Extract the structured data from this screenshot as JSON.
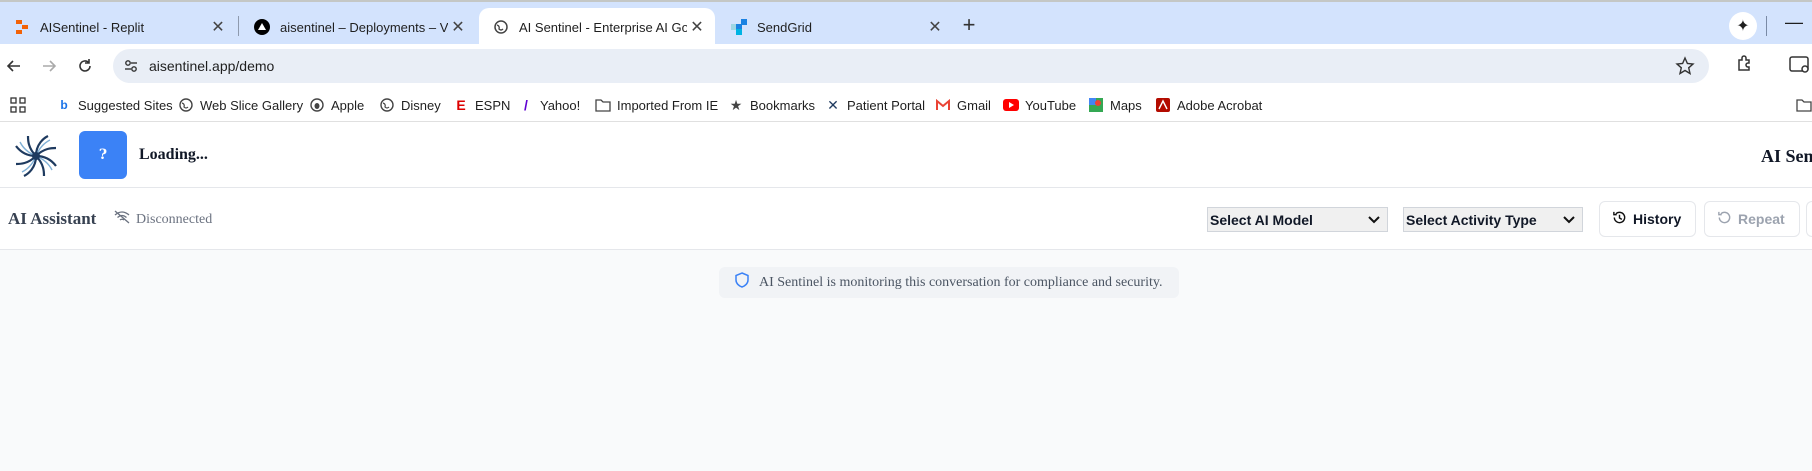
{
  "browser": {
    "tabs": [
      {
        "title": "AISentinel - Replit",
        "active": false,
        "favicon": "replit-icon"
      },
      {
        "title": "aisentinel – Deployments – Vercel",
        "active": false,
        "favicon": "vercel-icon"
      },
      {
        "title": "AI Sentinel - Enterprise AI Governance",
        "active": true,
        "favicon": "globe-icon"
      },
      {
        "title": "SendGrid",
        "active": false,
        "favicon": "sendgrid-icon"
      }
    ],
    "url": "aisentinel.app/demo",
    "bookmarks": [
      {
        "label": "Suggested Sites",
        "icon": "bing-icon"
      },
      {
        "label": "Web Slice Gallery",
        "icon": "globe-icon"
      },
      {
        "label": "Apple",
        "icon": "apple-icon"
      },
      {
        "label": "Disney",
        "icon": "globe-icon"
      },
      {
        "label": "ESPN",
        "icon": "espn-icon"
      },
      {
        "label": "Yahoo!",
        "icon": "yahoo-icon"
      },
      {
        "label": "Imported From IE",
        "icon": "folder-icon"
      },
      {
        "label": "Bookmarks",
        "icon": "star-icon"
      },
      {
        "label": "Patient Portal",
        "icon": "x-icon"
      },
      {
        "label": "Gmail",
        "icon": "gmail-icon"
      },
      {
        "label": "YouTube",
        "icon": "youtube-icon"
      },
      {
        "label": "Maps",
        "icon": "maps-icon"
      },
      {
        "label": "Adobe Acrobat",
        "icon": "acrobat-icon"
      }
    ]
  },
  "app": {
    "header": {
      "help_label": "?",
      "loading_text": "Loading...",
      "brand_text": "AI Sen"
    },
    "assistant": {
      "title": "AI Assistant",
      "status": "Disconnected",
      "model_select": "Select AI Model",
      "activity_select": "Select Activity Type",
      "history_label": "History",
      "repeat_label": "Repeat"
    },
    "notice": "AI Sentinel is monitoring this conversation for compliance and security.",
    "colors": {
      "primary": "#3b82f6",
      "tab_strip": "#d3e3fd",
      "notice_icon": "#3b82f6"
    }
  }
}
